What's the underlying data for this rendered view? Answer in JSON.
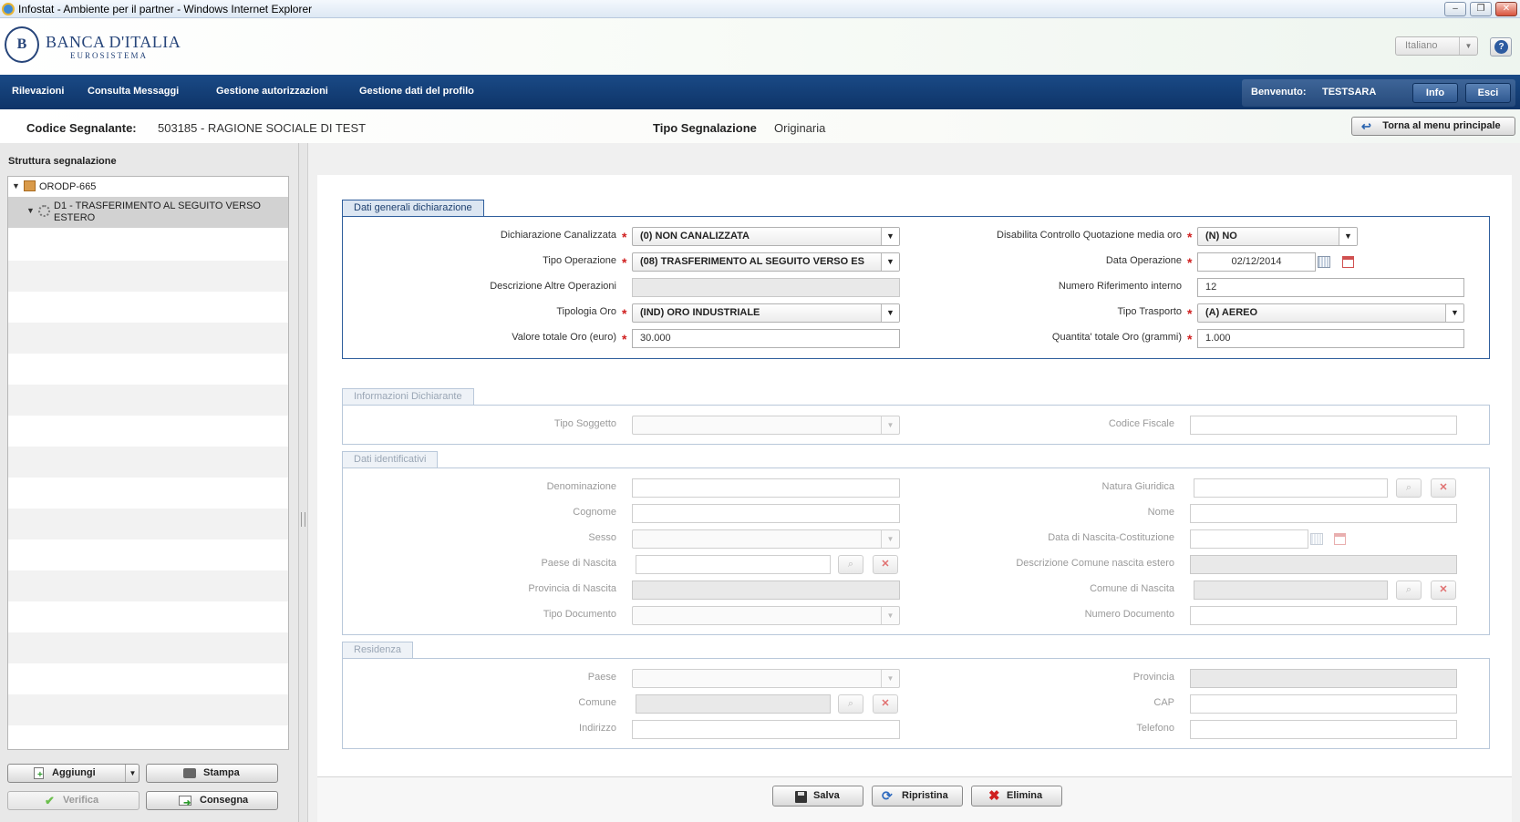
{
  "window": {
    "title": "Infostat - Ambiente per il partner - Windows Internet Explorer"
  },
  "header": {
    "logo_title": "BANCA D'ITALIA",
    "logo_sub": "EUROSISTEMA",
    "language": "Italiano",
    "help": "?"
  },
  "nav": {
    "items": [
      "Rilevazioni",
      "Consulta Messaggi",
      "Gestione autorizzazioni",
      "Gestione dati del profilo"
    ],
    "welcome_label": "Benvenuto:",
    "user": "TESTSARA",
    "info": "Info",
    "exit": "Esci"
  },
  "info": {
    "codice_label": "Codice Segnalante:",
    "codice_value": "503185 - RAGIONE SOCIALE DI TEST",
    "tipo_label": "Tipo Segnalazione",
    "tipo_value": "Originaria",
    "back_button": "Torna al menu principale"
  },
  "left": {
    "title": "Struttura segnalazione",
    "tree": [
      {
        "label": "ORODP-665"
      },
      {
        "label": "D1 - TRASFERIMENTO AL SEGUITO VERSO ESTERO"
      }
    ],
    "buttons": {
      "add": "Aggiungi",
      "print": "Stampa",
      "verify": "Verifica",
      "deliver": "Consegna"
    }
  },
  "dati_generali": {
    "title": "Dati generali dichiarazione",
    "dichiarazione_canalizzata": {
      "label": "Dichiarazione Canalizzata",
      "value": "(0) NON CANALIZZATA"
    },
    "tipo_operazione": {
      "label": "Tipo Operazione",
      "value": "(08) TRASFERIMENTO AL SEGUITO VERSO ES"
    },
    "descrizione_altre": {
      "label": "Descrizione Altre Operazioni",
      "value": ""
    },
    "tipologia_oro": {
      "label": "Tipologia Oro",
      "value": "(IND) ORO INDUSTRIALE"
    },
    "valore_totale": {
      "label": "Valore totale Oro (euro)",
      "value": "30.000"
    },
    "disabilita_controllo": {
      "label": "Disabilita Controllo Quotazione media oro",
      "value": "(N) NO"
    },
    "data_operazione": {
      "label": "Data Operazione",
      "value": "02/12/2014"
    },
    "numero_riferimento": {
      "label": "Numero Riferimento interno",
      "value": "12"
    },
    "tipo_trasporto": {
      "label": "Tipo Trasporto",
      "value": "(A) AEREO"
    },
    "quantita_totale": {
      "label": "Quantita' totale Oro (grammi)",
      "value": "1.000"
    }
  },
  "informazioni_dichiarante": {
    "title": "Informazioni Dichiarante",
    "tipo_soggetto": "Tipo Soggetto",
    "codice_fiscale": "Codice Fiscale"
  },
  "dati_identificativi": {
    "title": "Dati identificativi",
    "denominazione": "Denominazione",
    "cognome": "Cognome",
    "sesso": "Sesso",
    "paese_nascita": "Paese di Nascita",
    "provincia_nascita": "Provincia di Nascita",
    "tipo_documento": "Tipo Documento",
    "natura_giuridica": "Natura Giuridica",
    "nome": "Nome",
    "data_nascita": "Data di Nascita-Costituzione",
    "descrizione_comune_estero": "Descrizione Comune nascita estero",
    "comune_nascita": "Comune di Nascita",
    "numero_documento": "Numero Documento"
  },
  "residenza": {
    "title": "Residenza",
    "paese": "Paese",
    "comune": "Comune",
    "indirizzo": "Indirizzo",
    "provincia": "Provincia",
    "cap": "CAP",
    "telefono": "Telefono"
  },
  "actions": {
    "save": "Salva",
    "reset": "Ripristina",
    "delete": "Elimina"
  },
  "colors": {
    "nav": "#0e3468",
    "active_border": "#2f5e9c",
    "required": "#d02020"
  }
}
